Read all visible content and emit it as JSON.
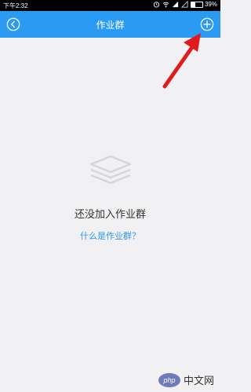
{
  "status_bar": {
    "time": "下午2:32",
    "battery": "39%",
    "battery_level": 0.39
  },
  "header": {
    "title": "作业群",
    "back_icon": "back-circle-icon",
    "add_icon": "add-circle-icon",
    "accent": "#2b9af3"
  },
  "empty_state": {
    "icon": "layers-stack-icon",
    "message": "还没加入作业群",
    "link": "什么是作业群？"
  },
  "watermark": {
    "logo": "php",
    "site": "中文网"
  },
  "annotation": {
    "arrow_color": "#e01b1b"
  }
}
